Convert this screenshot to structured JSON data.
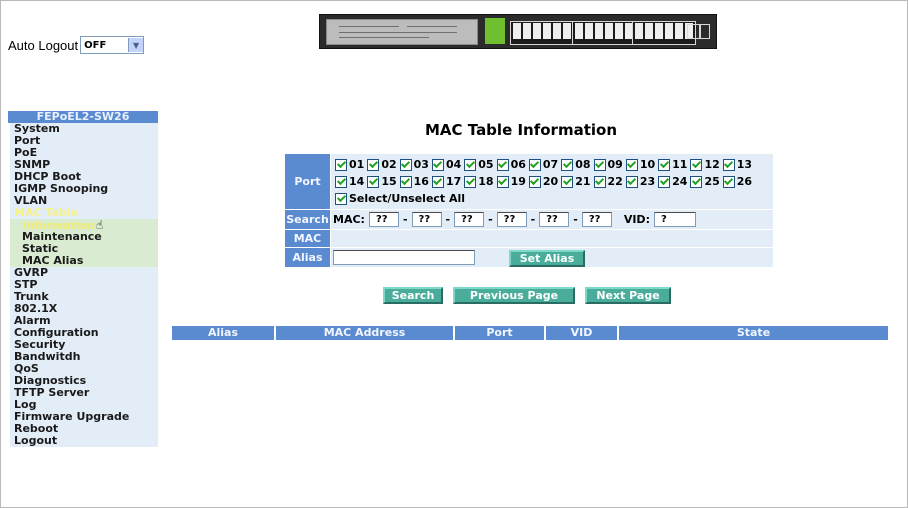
{
  "auto_logout": {
    "label": "Auto Logout",
    "value": "OFF"
  },
  "menu": {
    "title": "FEPoEL2-SW26",
    "items": [
      {
        "label": "System"
      },
      {
        "label": "Port"
      },
      {
        "label": "PoE"
      },
      {
        "label": "SNMP"
      },
      {
        "label": "DHCP Boot"
      },
      {
        "label": "IGMP Snooping"
      },
      {
        "label": "VLAN"
      },
      {
        "label": "MAC Table"
      },
      {
        "label": "Information"
      },
      {
        "label": "Maintenance"
      },
      {
        "label": "Static"
      },
      {
        "label": "MAC Alias"
      },
      {
        "label": "GVRP"
      },
      {
        "label": "STP"
      },
      {
        "label": "Trunk"
      },
      {
        "label": "802.1X"
      },
      {
        "label": "Alarm"
      },
      {
        "label": "Configuration"
      },
      {
        "label": "Security"
      },
      {
        "label": "Bandwitdh"
      },
      {
        "label": "QoS"
      },
      {
        "label": "Diagnostics"
      },
      {
        "label": "TFTP Server"
      },
      {
        "label": "Log"
      },
      {
        "label": "Firmware Upgrade"
      },
      {
        "label": "Reboot"
      },
      {
        "label": "Logout"
      }
    ]
  },
  "page_title": "MAC Table Information",
  "form": {
    "port_label": "Port",
    "search_label": "Search",
    "mac_label": "MAC",
    "alias_label": "Alias",
    "ports_row1": [
      "01",
      "02",
      "03",
      "04",
      "05",
      "06",
      "07",
      "08",
      "09",
      "10",
      "11",
      "12",
      "13"
    ],
    "ports_row2": [
      "14",
      "15",
      "16",
      "17",
      "18",
      "19",
      "20",
      "21",
      "22",
      "23",
      "24",
      "25",
      "26"
    ],
    "select_all": "Select/Unselect All",
    "mac_prefix": "MAC:",
    "mac_octets": [
      "??",
      "??",
      "??",
      "??",
      "??",
      "??"
    ],
    "vid_label": "VID:",
    "vid_value": "?",
    "alias_value": "",
    "set_alias": "Set Alias"
  },
  "buttons": {
    "search": "Search",
    "previous": "Previous Page",
    "next": "Next Page"
  },
  "table": {
    "columns": [
      "Alias",
      "MAC Address",
      "Port",
      "VID",
      "State"
    ]
  },
  "colors": {
    "header_blue": "#5a8ad0",
    "panel_bg": "#e3edf8",
    "button_teal": "#4aad9b",
    "active_menu": "#f5f28a"
  }
}
